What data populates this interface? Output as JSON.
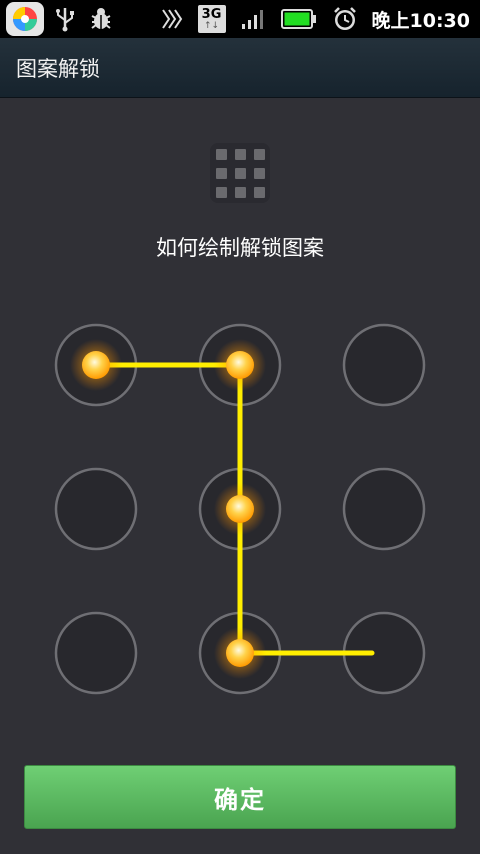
{
  "status_bar": {
    "icons": [
      "app-store-icon",
      "usb-icon",
      "debug-bug-icon",
      "data-transfer-icon",
      "network-3g-icon",
      "signal-icon",
      "battery-icon",
      "alarm-icon"
    ],
    "network_label": "3G",
    "time": "晚上10:30"
  },
  "title_bar": {
    "title": "图案解锁"
  },
  "main": {
    "hint": "如何绘制解锁图案",
    "pattern": {
      "rows": 3,
      "cols": 3,
      "selected_nodes": [
        1,
        2,
        5,
        8
      ],
      "trailing_path": true
    },
    "confirm_label": "确定"
  },
  "colors": {
    "background": "#303036",
    "title_bar": "#1b2731",
    "path": "#ffee00",
    "node_glow": "#ffb000",
    "button": "#5dbb62"
  }
}
